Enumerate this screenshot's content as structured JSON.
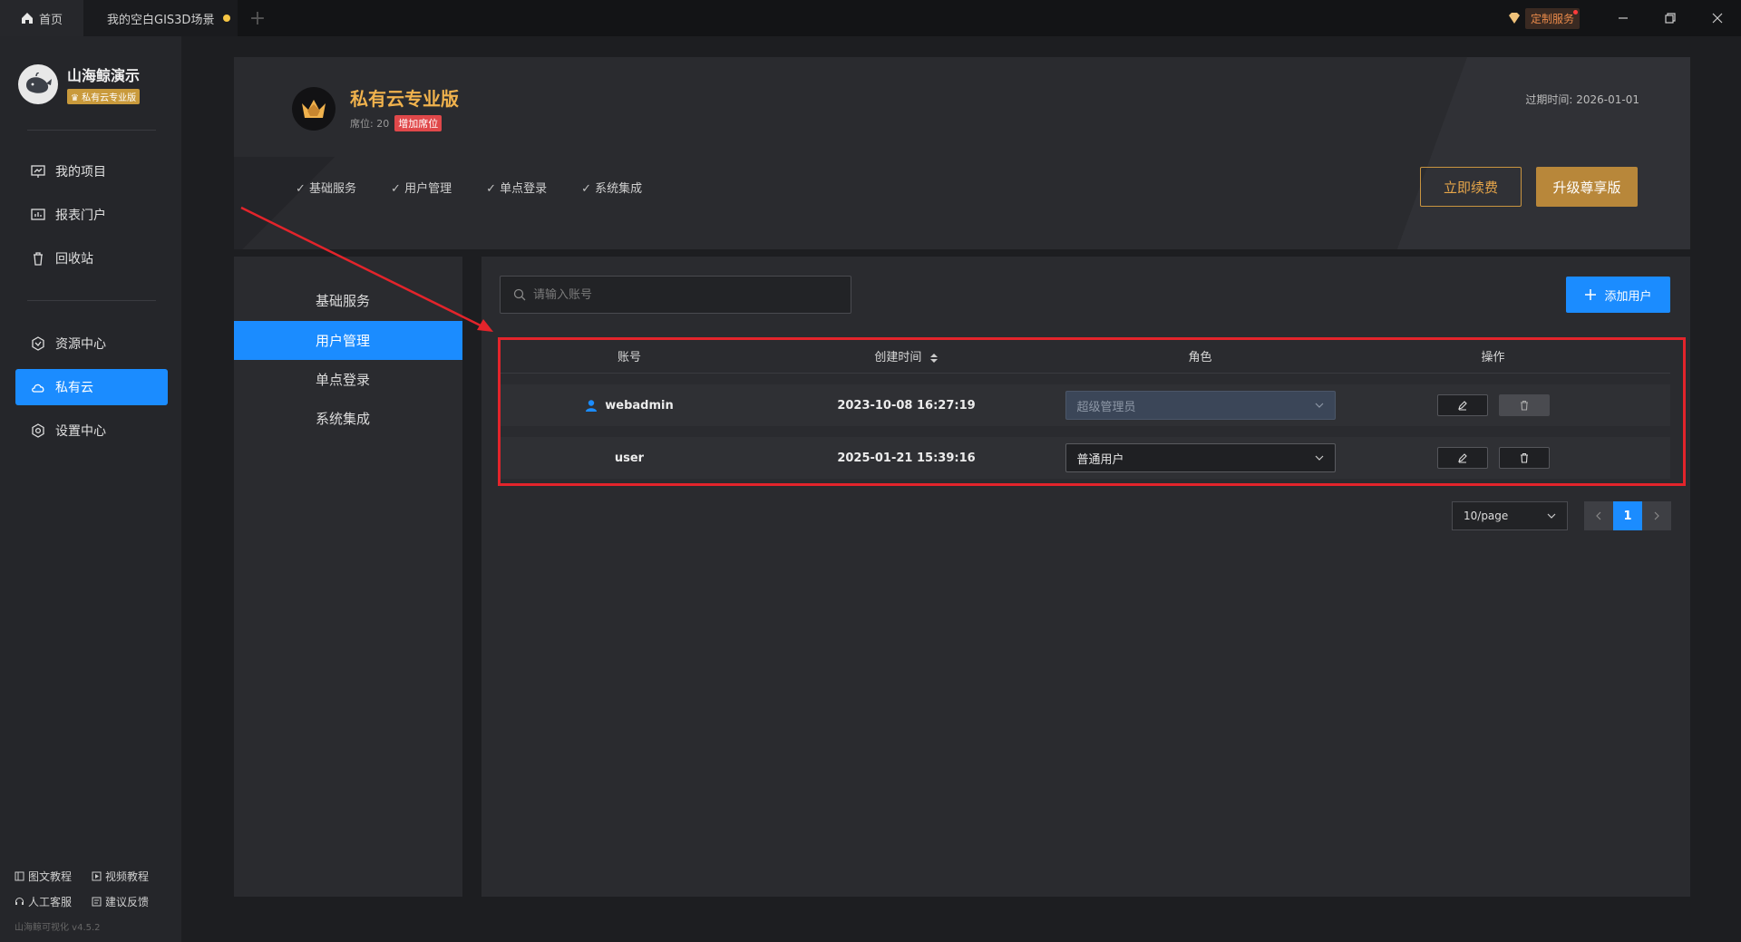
{
  "titlebar": {
    "tabs": [
      {
        "label": "首页"
      },
      {
        "label": "我的空白GIS3D场景"
      }
    ],
    "custom_service": "定制服务"
  },
  "sidebar": {
    "brand_name": "山海鲸演示",
    "edition": "私有云专业版",
    "items": [
      {
        "label": "我的项目"
      },
      {
        "label": "报表门户"
      },
      {
        "label": "回收站"
      },
      {
        "label": "资源中心"
      },
      {
        "label": "私有云"
      },
      {
        "label": "设置中心"
      }
    ],
    "footer": [
      {
        "label": "图文教程"
      },
      {
        "label": "视频教程"
      },
      {
        "label": "人工客服"
      },
      {
        "label": "建议反馈"
      }
    ],
    "version": "山海鲸可视化 v4.5.2"
  },
  "plan": {
    "name": "私有云专业版",
    "seats": "席位: 20",
    "add_seat": "增加席位",
    "expire": "过期时间:  2026-01-01",
    "features": [
      "基础服务",
      "用户管理",
      "单点登录",
      "系统集成"
    ],
    "renew_label": "立即续费",
    "upgrade_label": "升级尊享版"
  },
  "submenu": {
    "items": [
      {
        "label": "基础服务"
      },
      {
        "label": "用户管理"
      },
      {
        "label": "单点登录"
      },
      {
        "label": "系统集成"
      }
    ]
  },
  "main": {
    "search_placeholder": "请输入账号",
    "add_user_label": "添加用户",
    "columns": [
      "账号",
      "创建时间",
      "角色",
      "操作"
    ],
    "rows": [
      {
        "account": "webadmin",
        "created": "2023-10-08 16:27:19",
        "role": "超级管理员"
      },
      {
        "account": "user",
        "created": "2025-01-21 15:39:16",
        "role": "普通用户"
      }
    ],
    "page_size": "10/page",
    "current_page": "1"
  },
  "colors": {
    "accent": "#1b8cff",
    "gold": "#b8873a",
    "highlight": "#e3242b"
  }
}
